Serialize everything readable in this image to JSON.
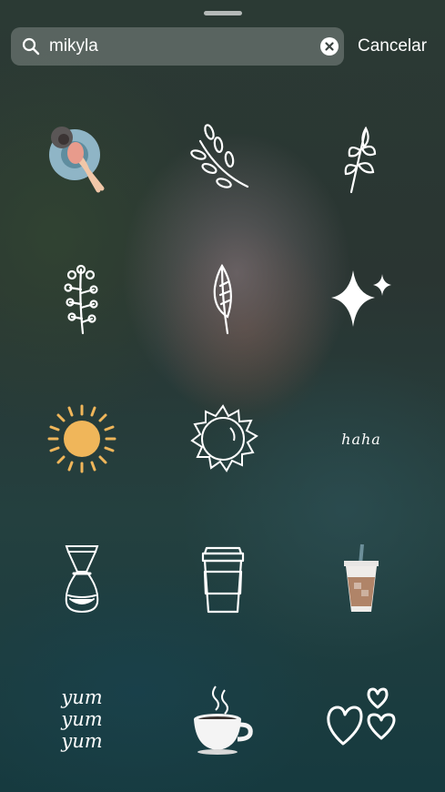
{
  "search": {
    "query": "mikyla",
    "cancel_label": "Cancelar"
  },
  "stickers": [
    {
      "name": "woman-on-pool-float-sticker"
    },
    {
      "name": "olive-branch-sticker"
    },
    {
      "name": "leafy-sprig-sticker"
    },
    {
      "name": "flower-sprig-sticker"
    },
    {
      "name": "single-leaf-sticker"
    },
    {
      "name": "sparkles-sticker"
    },
    {
      "name": "yellow-sun-sticker"
    },
    {
      "name": "outline-sun-sticker"
    },
    {
      "name": "haha-text-sticker",
      "text": "haha"
    },
    {
      "name": "coffee-carafe-sticker"
    },
    {
      "name": "reusable-cup-sticker"
    },
    {
      "name": "iced-coffee-sticker"
    },
    {
      "name": "yum-text-sticker",
      "lines": [
        "yum",
        "yum",
        "yum"
      ]
    },
    {
      "name": "hot-coffee-cup-sticker"
    },
    {
      "name": "hearts-sticker"
    }
  ],
  "colors": {
    "sun_yellow": "#f0b65a",
    "float_blue": "#8fb5c6",
    "cup_brown": "#b08468"
  }
}
